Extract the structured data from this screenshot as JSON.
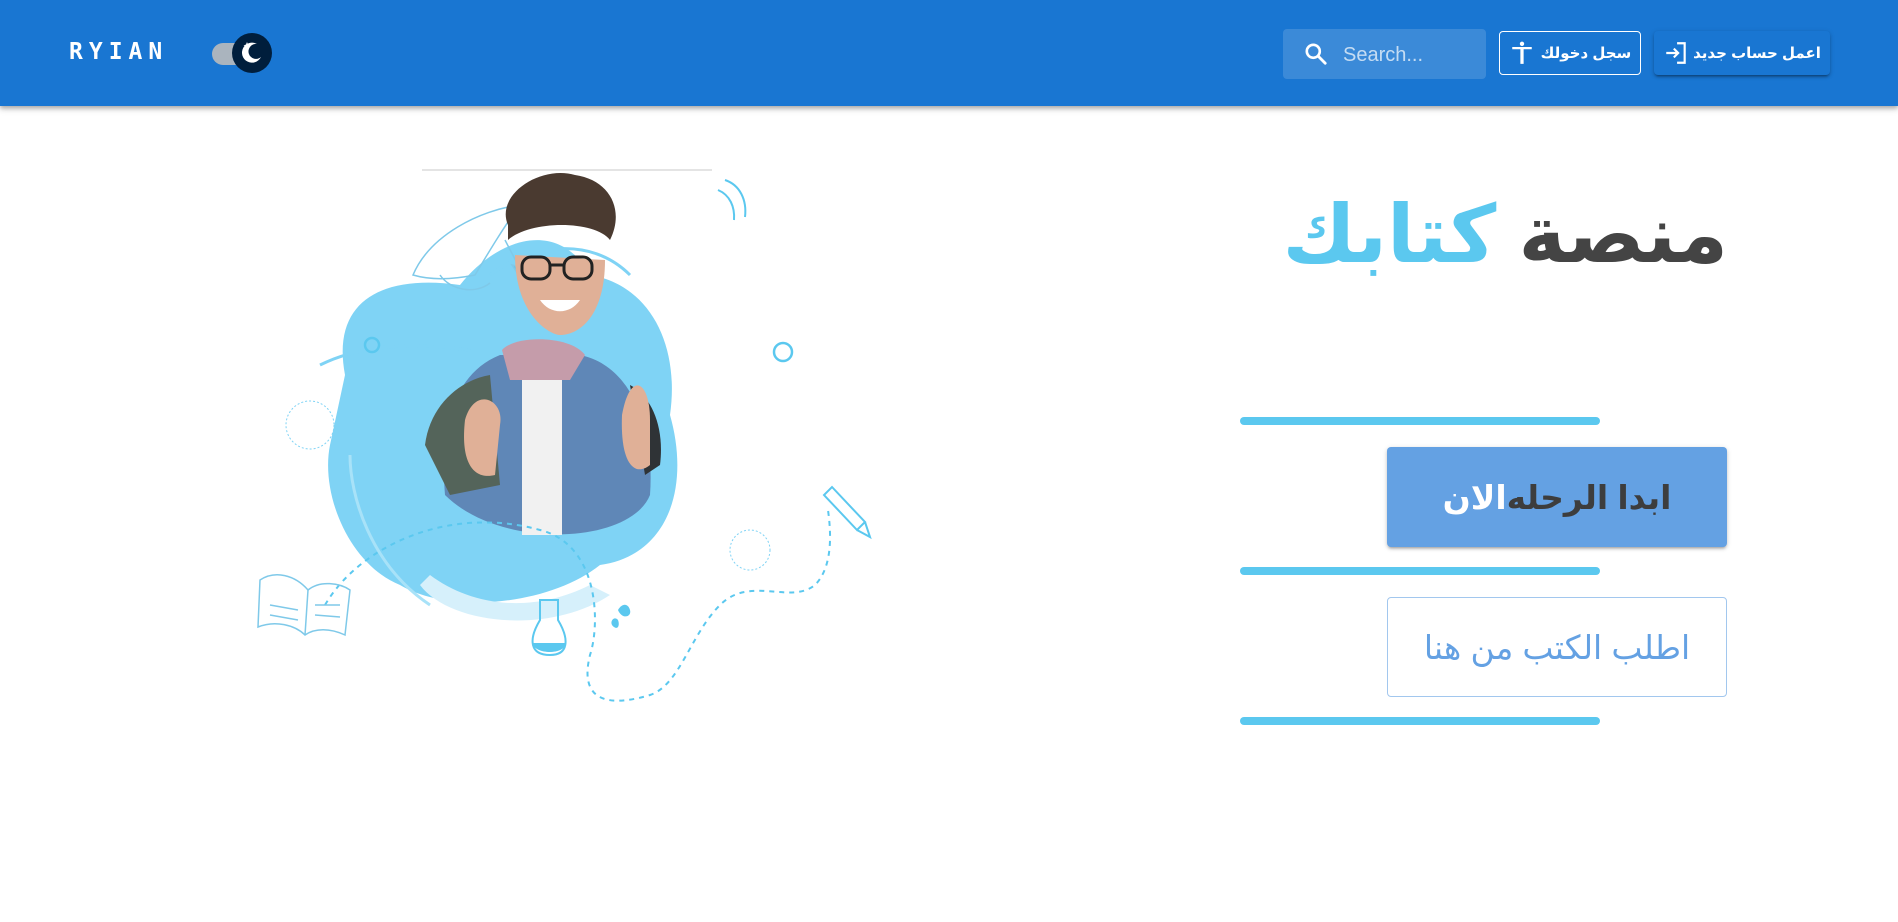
{
  "header": {
    "logo": "RYIAN",
    "theme_toggle": {
      "mode": "dark",
      "icon": "moon-icon"
    },
    "search": {
      "placeholder": "Search...",
      "value": "",
      "icon": "search-icon"
    },
    "login_button": {
      "label": "سجل دخولك",
      "icon": "accessibility-icon"
    },
    "signup_button": {
      "label": "اعمل حساب جديد",
      "icon": "login-icon"
    }
  },
  "hero": {
    "title_part1": "منصة",
    "title_part2": "كتابك",
    "start_button": {
      "label_part1": "ابدا الرحله",
      "label_part2": "الان"
    },
    "books_button": {
      "label": "اطلب الكتب من هنا"
    }
  },
  "colors": {
    "appbar": "#1976d2",
    "accent": "#5bc8ef",
    "button": "#64a1e3",
    "title": "#444444"
  }
}
